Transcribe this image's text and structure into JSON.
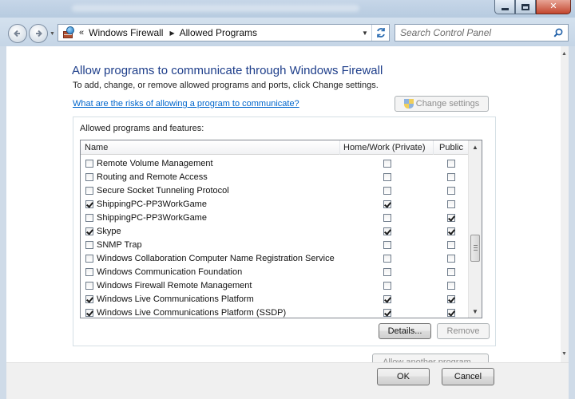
{
  "window": {
    "caption_buttons": {
      "minimize": "minimize",
      "maximize": "maximize",
      "close": "✕"
    }
  },
  "navigation": {
    "back_icon": "back-arrow-icon",
    "forward_icon": "forward-arrow-icon",
    "breadcrumb": {
      "overflow": "«",
      "items": [
        "Windows Firewall",
        "Allowed Programs"
      ]
    },
    "search_placeholder": "Search Control Panel"
  },
  "main": {
    "heading": "Allow programs to communicate through Windows Firewall",
    "subtext": "To add, change, or remove allowed programs and ports, click Change settings.",
    "risk_link": "What are the risks of allowing a program to communicate?",
    "change_settings_label": "Change settings",
    "group_label": "Allowed programs and features:",
    "columns": {
      "name": "Name",
      "home": "Home/Work (Private)",
      "public": "Public"
    },
    "programs": [
      {
        "name": "Remote Volume Management",
        "enabled": false,
        "home": false,
        "public": false
      },
      {
        "name": "Routing and Remote Access",
        "enabled": false,
        "home": false,
        "public": false
      },
      {
        "name": "Secure Socket Tunneling Protocol",
        "enabled": false,
        "home": false,
        "public": false
      },
      {
        "name": "ShippingPC-PP3WorkGame",
        "enabled": true,
        "home": true,
        "public": false
      },
      {
        "name": "ShippingPC-PP3WorkGame",
        "enabled": false,
        "home": false,
        "public": true
      },
      {
        "name": "Skype",
        "enabled": true,
        "home": true,
        "public": true
      },
      {
        "name": "SNMP Trap",
        "enabled": false,
        "home": false,
        "public": false
      },
      {
        "name": "Windows Collaboration Computer Name Registration Service",
        "enabled": false,
        "home": false,
        "public": false
      },
      {
        "name": "Windows Communication Foundation",
        "enabled": false,
        "home": false,
        "public": false
      },
      {
        "name": "Windows Firewall Remote Management",
        "enabled": false,
        "home": false,
        "public": false
      },
      {
        "name": "Windows Live Communications Platform",
        "enabled": true,
        "home": true,
        "public": true
      },
      {
        "name": "Windows Live Communications Platform (SSDP)",
        "enabled": true,
        "home": true,
        "public": true
      }
    ],
    "details_label": "Details...",
    "remove_label": "Remove",
    "allow_another_label": "Allow another program..."
  },
  "footer": {
    "ok_label": "OK",
    "cancel_label": "Cancel"
  }
}
